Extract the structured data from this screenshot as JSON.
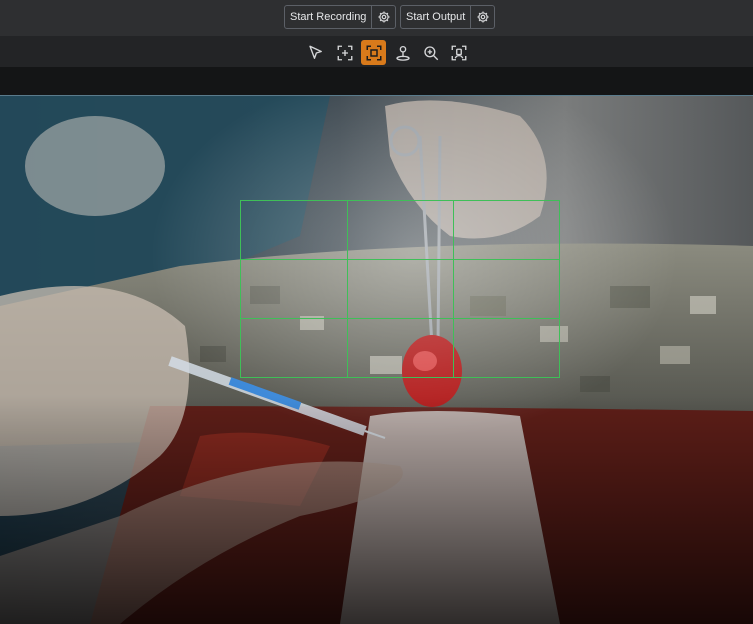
{
  "controls": {
    "recording": {
      "label": "Start Recording",
      "settings_icon": "gear-icon"
    },
    "output": {
      "label": "Start Output",
      "settings_icon": "gear-icon"
    }
  },
  "toolbar": {
    "tools": [
      {
        "name": "select-tool",
        "icon": "cursor-arrow-icon",
        "active": false
      },
      {
        "name": "add-region-tool",
        "icon": "crosshair-frame-icon",
        "active": false
      },
      {
        "name": "crop-tool",
        "icon": "crop-frame-icon",
        "active": true
      },
      {
        "name": "pin-tool",
        "icon": "map-pin-icon",
        "active": false
      },
      {
        "name": "zoom-tool",
        "icon": "zoom-in-icon",
        "active": false
      },
      {
        "name": "face-frame-tool",
        "icon": "face-frame-icon",
        "active": false
      }
    ],
    "active_color": "#d87a1b"
  },
  "overlay": {
    "grid_color": "#3fbf58",
    "grid_rows": 3,
    "grid_cols": 3
  }
}
